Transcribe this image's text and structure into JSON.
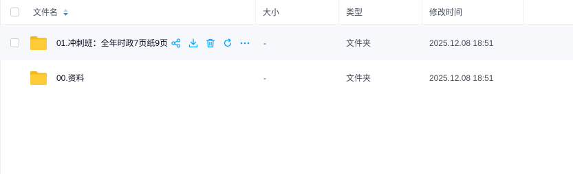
{
  "header": {
    "name_label": "文件名",
    "size_label": "大小",
    "type_label": "类型",
    "modified_label": "修改时间"
  },
  "rows": [
    {
      "name": "01.冲刺班：全年时政7页纸9页",
      "size": "-",
      "type": "文件夹",
      "modified": "2025.12.08 18:51",
      "hovered": true
    },
    {
      "name": "00.资料",
      "size": "-",
      "type": "文件夹",
      "modified": "2025.12.08 18:51",
      "hovered": false
    }
  ],
  "icons": {
    "folder": "folder-icon",
    "share": "share-icon",
    "download": "download-icon",
    "delete": "trash-icon",
    "refresh": "refresh-icon",
    "more": "more-icon"
  },
  "colors": {
    "accent": "#06a7ff",
    "folder": "#ffcc39",
    "row_hover": "#f6f8fc"
  }
}
